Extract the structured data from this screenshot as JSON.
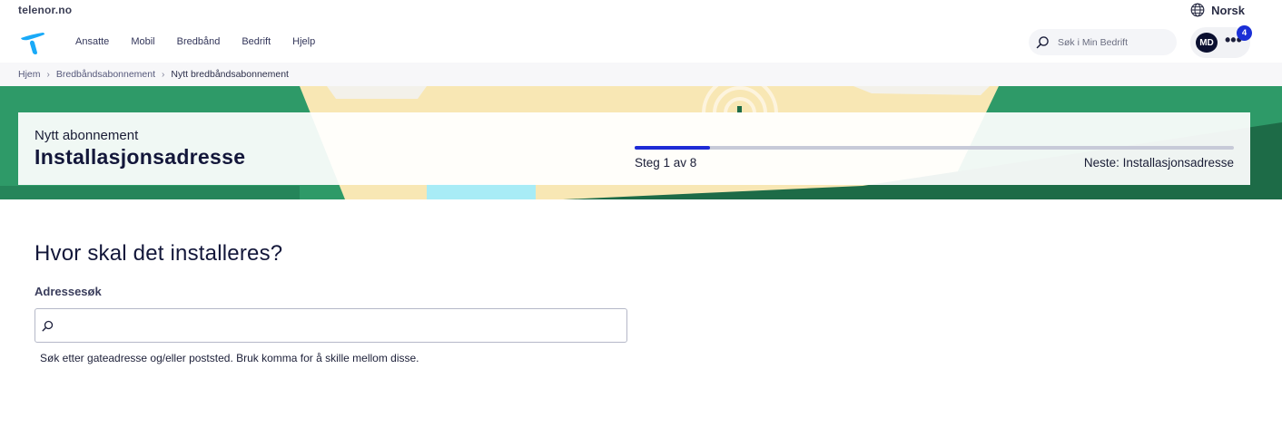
{
  "topbar": {
    "site_link": "telenor.no",
    "language": "Norsk"
  },
  "nav": {
    "items": [
      {
        "label": "Ansatte"
      },
      {
        "label": "Mobil"
      },
      {
        "label": "Bredbånd"
      },
      {
        "label": "Bedrift"
      },
      {
        "label": "Hjelp"
      }
    ],
    "search_placeholder": "Søk i Min Bedrift",
    "avatar_initials": "MD",
    "notification_count": "4"
  },
  "breadcrumb": {
    "items": [
      "Hjem",
      "Bredbåndsabonnement",
      "Nytt bredbåndsabonnement"
    ]
  },
  "hero": {
    "subtitle": "Nytt abonnement",
    "title": "Installasjonsadresse",
    "step_text": "Steg 1 av 8",
    "next_text": "Neste: Installasjonsadresse",
    "progress_fraction": 0.125
  },
  "form": {
    "question": "Hvor skal det installeres?",
    "field_label": "Adressesøk",
    "input_value": "",
    "help_text": "Søk etter gateadresse og/eller poststed. Bruk komma for å skille mellom disse."
  },
  "colors": {
    "brand_blue": "#1f2bd6",
    "hero_green": "#2e9a68",
    "dark_navy": "#0b1030"
  },
  "icons": {
    "language": "globe-icon",
    "search": "search-icon",
    "more": "more-dots-icon",
    "breadcrumb_separator": "chevron-right-icon"
  }
}
